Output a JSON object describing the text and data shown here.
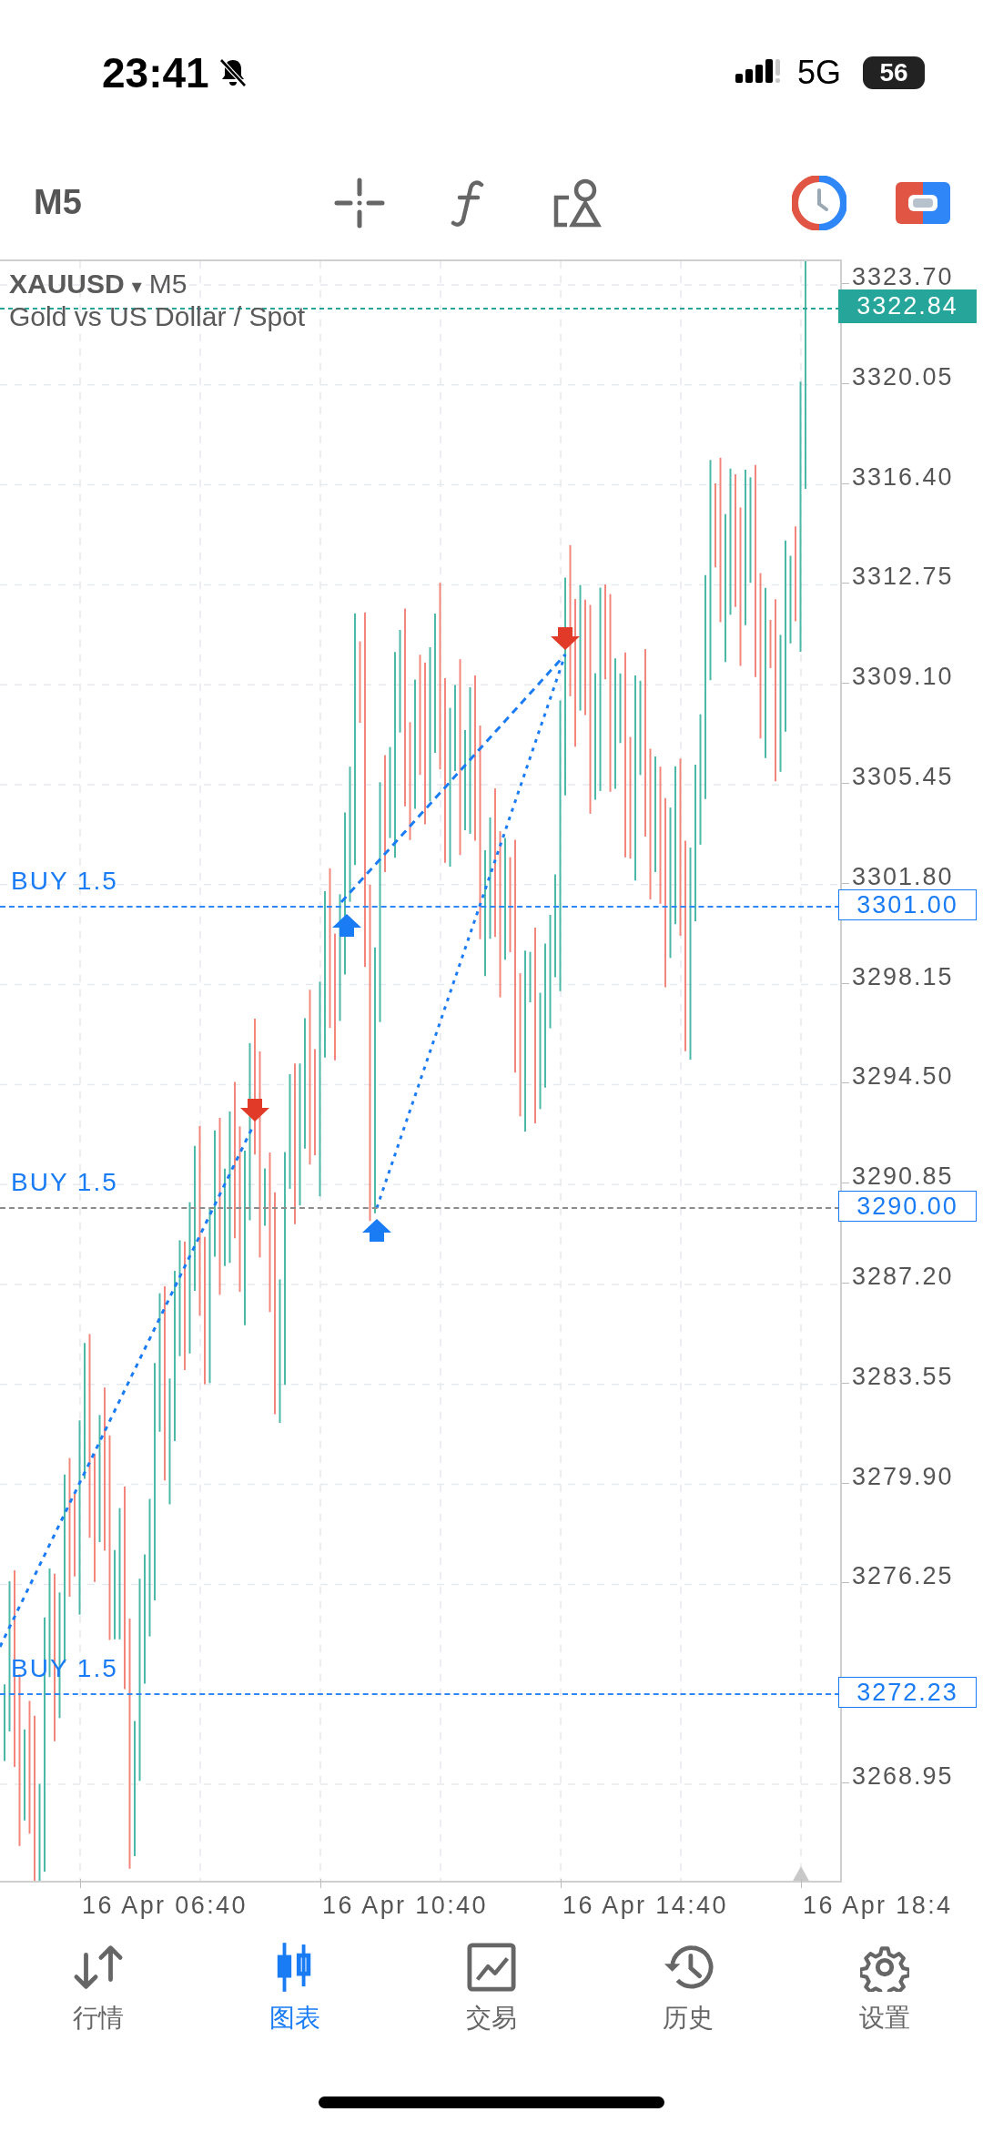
{
  "status_bar": {
    "time": "23:41",
    "network": "5G",
    "battery": "56"
  },
  "toolbar": {
    "timeframe": "M5"
  },
  "chart": {
    "symbol": "XAUUSD",
    "symbol_caret": "▾",
    "timeframe": "M5",
    "description": "Gold vs US Dollar / Spot",
    "current_price": "3322.84",
    "price_ticks": [
      "3323.70",
      "3320.05",
      "3316.40",
      "3312.75",
      "3309.10",
      "3305.45",
      "3301.80",
      "3298.15",
      "3294.50",
      "3290.85",
      "3287.20",
      "3283.55",
      "3279.90",
      "3276.25",
      "3268.95"
    ],
    "orders": [
      {
        "label": "BUY 1.5",
        "price": "3301.00",
        "color": "#2f86f6"
      },
      {
        "label": "BUY 1.5",
        "price": "3290.00",
        "color": "#8c8c8c"
      },
      {
        "label": "BUY 1.5",
        "price": "3272.23",
        "color": "#2f86f6"
      }
    ],
    "time_labels": [
      "16 Apr 06:40",
      "16 Apr 10:40",
      "16 Apr 14:40",
      "16 Apr 18:4"
    ]
  },
  "nav": [
    {
      "label": "行情",
      "selected": false
    },
    {
      "label": "图表",
      "selected": true
    },
    {
      "label": "交易",
      "selected": false
    },
    {
      "label": "历史",
      "selected": false
    },
    {
      "label": "设置",
      "selected": false
    }
  ]
}
